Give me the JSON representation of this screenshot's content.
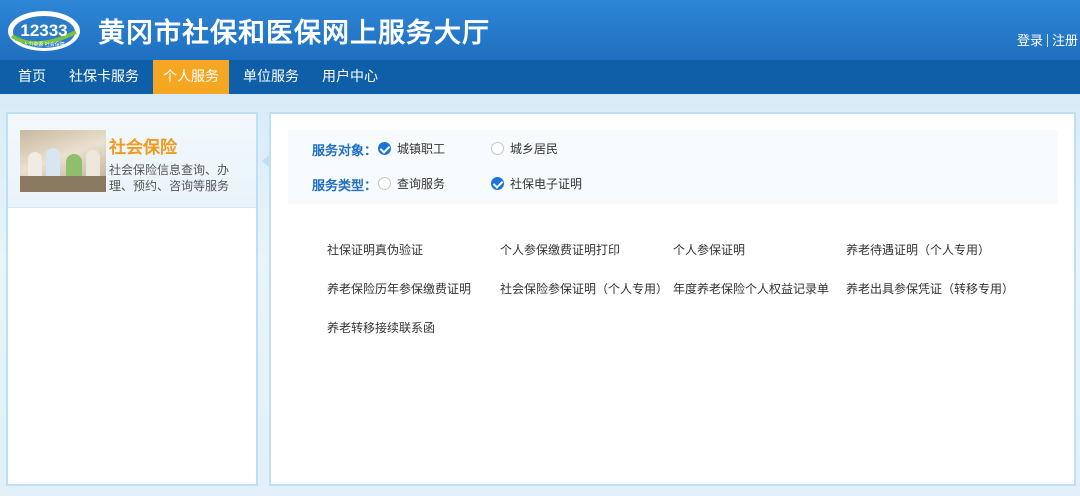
{
  "header": {
    "logo_number": "12333",
    "logo_sub": "人力资源 社会保障",
    "title": "黄冈市社保和医保网上服务大厅",
    "login": "登录",
    "register": "注册"
  },
  "nav": {
    "items": [
      {
        "label": "首页"
      },
      {
        "label": "社保卡服务"
      },
      {
        "label": "个人服务"
      },
      {
        "label": "单位服务"
      },
      {
        "label": "用户中心"
      }
    ],
    "active": "个人服务"
  },
  "sidebar": {
    "card_title": "社会保险",
    "card_desc": "社会保险信息查询、办理、预约、咨询等服务"
  },
  "filters": {
    "service_target_label": "服务对象：",
    "service_target_options": [
      {
        "label": "城镇职工",
        "checked": true
      },
      {
        "label": "城乡居民",
        "checked": false
      }
    ],
    "service_type_label": "服务类型：",
    "service_type_options": [
      {
        "label": "查询服务",
        "checked": false
      },
      {
        "label": "社保电子证明",
        "checked": true
      }
    ]
  },
  "services": [
    "社保证明真伪验证",
    "个人参保缴费证明打印",
    "个人参保证明",
    "养老待遇证明（个人专用）",
    "养老保险历年参保缴费证明",
    "社会保险参保证明（个人专用）",
    "年度养老保险个人权益记录单",
    "养老出具参保凭证（转移专用）",
    "养老转移接续联系函"
  ],
  "colors": {
    "header_blue": "#1f6fc0",
    "nav_blue": "#0e5fa8",
    "active_orange": "#f5a623",
    "title_orange": "#f09a1e",
    "check_blue": "#1a73d9"
  }
}
